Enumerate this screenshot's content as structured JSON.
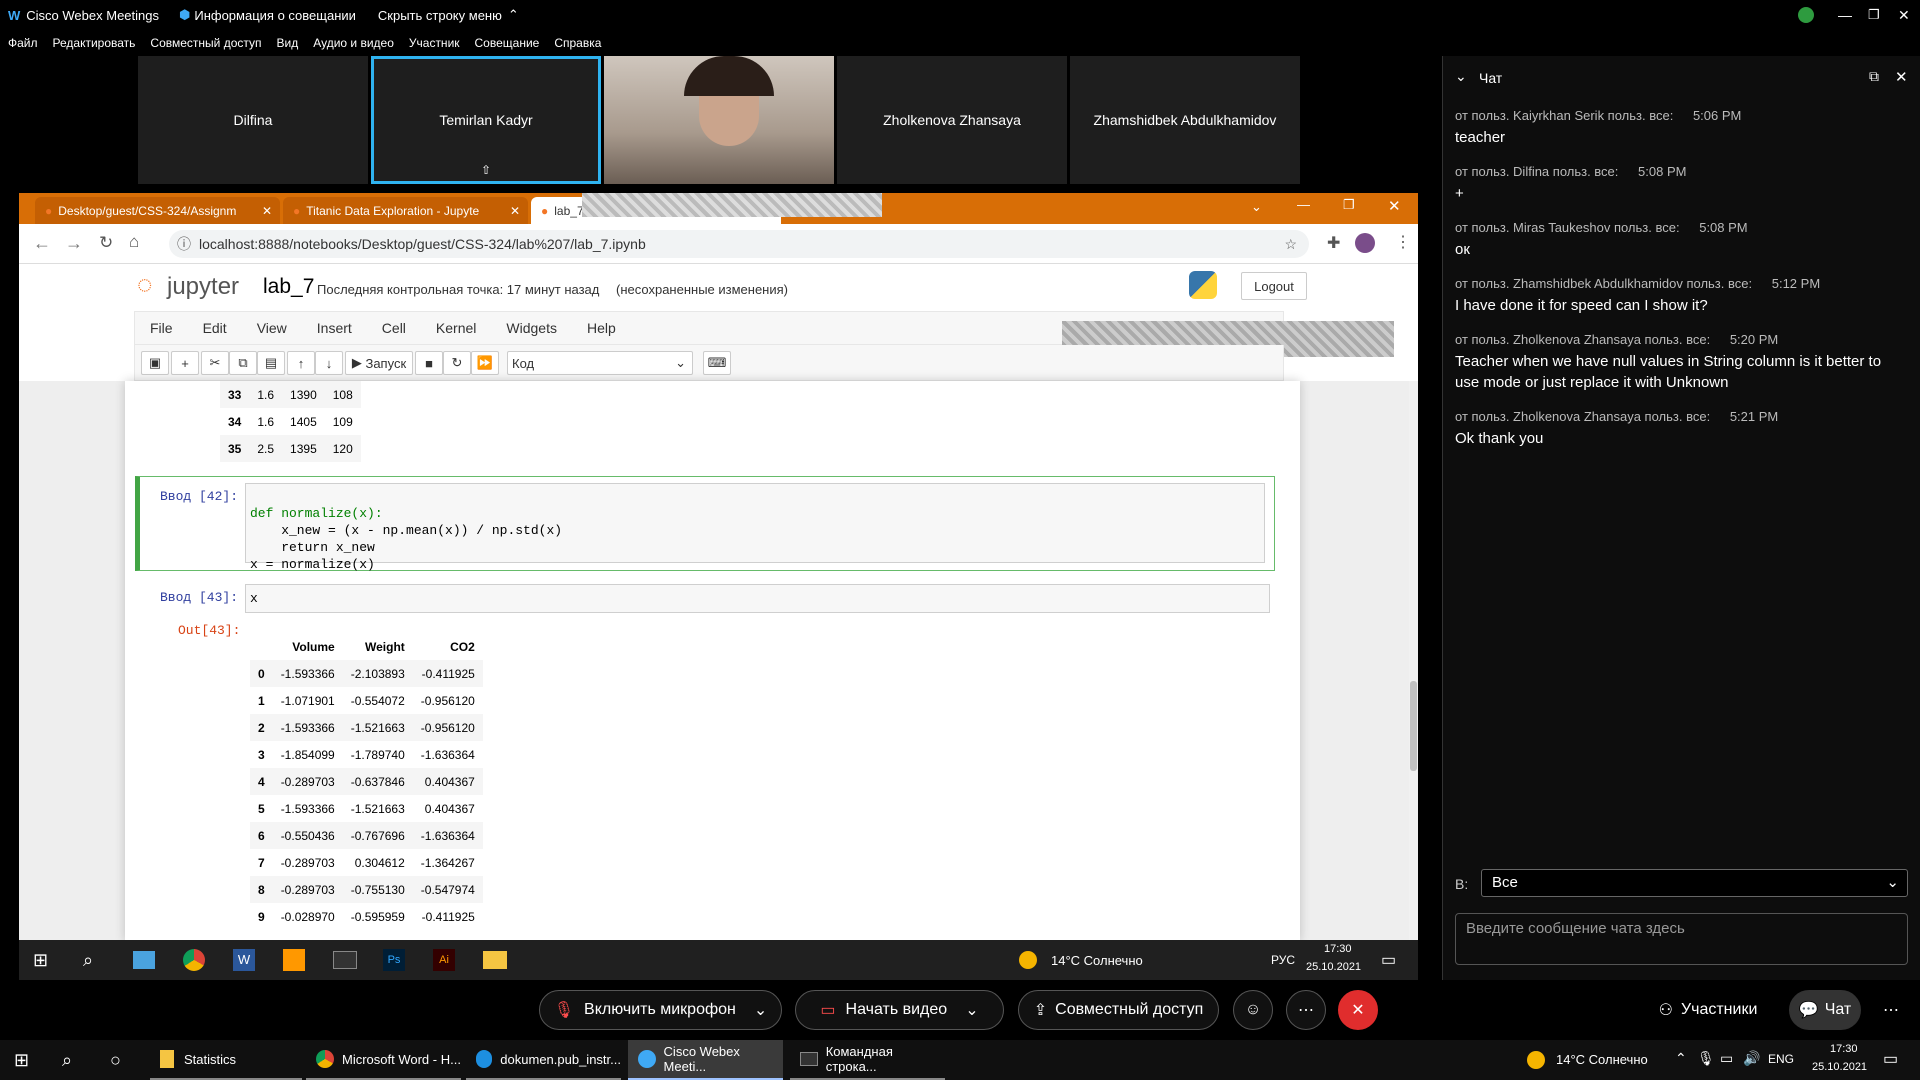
{
  "webex": {
    "app_title": "Cisco Webex Meetings",
    "meeting_info": "Информация о совещании",
    "hide_menu": "Скрыть строку меню",
    "menu": [
      "Файл",
      "Редактировать",
      "Совместный доступ",
      "Вид",
      "Аудио и видео",
      "Участник",
      "Совещание",
      "Справка"
    ],
    "participants": [
      "Dilfina",
      "Temirlan Kadyr",
      "",
      "Zholkenova Zhansaya",
      "Zhamshidbek Abdulkhamidov"
    ],
    "controls": {
      "mic": "Включить микрофон",
      "video": "Начать видео",
      "share": "Совместный доступ",
      "participants": "Участники",
      "chat": "Чат"
    }
  },
  "browser": {
    "tabs": [
      "Desktop/guest/CSS-324/Assignm",
      "Titanic Data Exploration - Jupyte",
      "lab_7"
    ],
    "url": "localhost:8888/notebooks/Desktop/guest/CSS-324/lab%207/lab_7.ipynb"
  },
  "jupyter": {
    "logo": "jupyter",
    "notebook_name": "lab_7",
    "checkpoint": "Последняя контрольная точка: 17 минут назад",
    "unsaved": "(несохраненные изменения)",
    "logout": "Logout",
    "menu": [
      "File",
      "Edit",
      "View",
      "Insert",
      "Cell",
      "Kernel",
      "Widgets",
      "Help"
    ],
    "run_label": "Запуск",
    "cell_type": "Код",
    "prev_rows": [
      {
        "idx": "33",
        "v": "1.6",
        "w": "1390",
        "c": "108"
      },
      {
        "idx": "34",
        "v": "1.6",
        "w": "1405",
        "c": "109"
      },
      {
        "idx": "35",
        "v": "2.5",
        "w": "1395",
        "c": "120"
      }
    ],
    "cell42_prompt": "Ввод [42]:",
    "cell42_code": [
      "def normalize(x):",
      "    x_new = (x - np.mean(x)) / np.std(x)",
      "    return x_new",
      "x = normalize(x)"
    ],
    "cell43_prompt": "Ввод [43]:",
    "cell43_code": "x",
    "out43_prompt": "Out[43]:",
    "table_headers": [
      "",
      "Volume",
      "Weight",
      "CO2"
    ],
    "table_rows": [
      [
        "0",
        "-1.593366",
        "-2.103893",
        "-0.411925"
      ],
      [
        "1",
        "-1.071901",
        "-0.554072",
        "-0.956120"
      ],
      [
        "2",
        "-1.593366",
        "-1.521663",
        "-0.956120"
      ],
      [
        "3",
        "-1.854099",
        "-1.789740",
        "-1.636364"
      ],
      [
        "4",
        "-0.289703",
        "-0.637846",
        "0.404367"
      ],
      [
        "5",
        "-1.593366",
        "-1.521663",
        "0.404367"
      ],
      [
        "6",
        "-0.550436",
        "-0.767696",
        "-1.636364"
      ],
      [
        "7",
        "-0.289703",
        "0.304612",
        "-1.364267"
      ],
      [
        "8",
        "-0.289703",
        "-0.755130",
        "-0.547974"
      ],
      [
        "9",
        "-0.028970",
        "-0.595959",
        "-0.411925"
      ]
    ]
  },
  "inner_taskbar": {
    "weather": "14°C Солнечно",
    "lang": "РУС",
    "time": "17:30",
    "date": "25.10.2021"
  },
  "chat": {
    "title": "Чат",
    "messages": [
      {
        "from": "от польз. Kaiyrkhan Serik польз. все:",
        "time": "5:06 PM",
        "text": "teacher"
      },
      {
        "from": "от польз. Dilfina польз. все:",
        "time": "5:08 PM",
        "text": "+"
      },
      {
        "from": "от польз. Miras Taukeshov польз. все:",
        "time": "5:08 PM",
        "text": "ок"
      },
      {
        "from": "от польз. Zhamshidbek Abdulkhamidov польз. все:",
        "time": "5:12 PM",
        "text": "I have done it for speed can I show it?"
      },
      {
        "from": "от польз. Zholkenova Zhansaya польз. все:",
        "time": "5:20 PM",
        "text": "Teacher when we have null values in String column is it better to use mode or just replace it with Unknown"
      },
      {
        "from": "от польз. Zholkenova Zhansaya польз. все:",
        "time": "5:21 PM",
        "text": "Ok thank you"
      }
    ],
    "to_label": "В:",
    "to_value": "Все",
    "input_placeholder": "Введите сообщение чата здесь"
  },
  "os_taskbar": {
    "items": [
      "Statistics",
      "Microsoft Word - H...",
      "dokumen.pub_instr...",
      "Cisco Webex Meeti...",
      "Командная строка..."
    ],
    "weather": "14°C Солнечно",
    "lang": "ENG",
    "time": "17:30",
    "date": "25.10.2021"
  }
}
